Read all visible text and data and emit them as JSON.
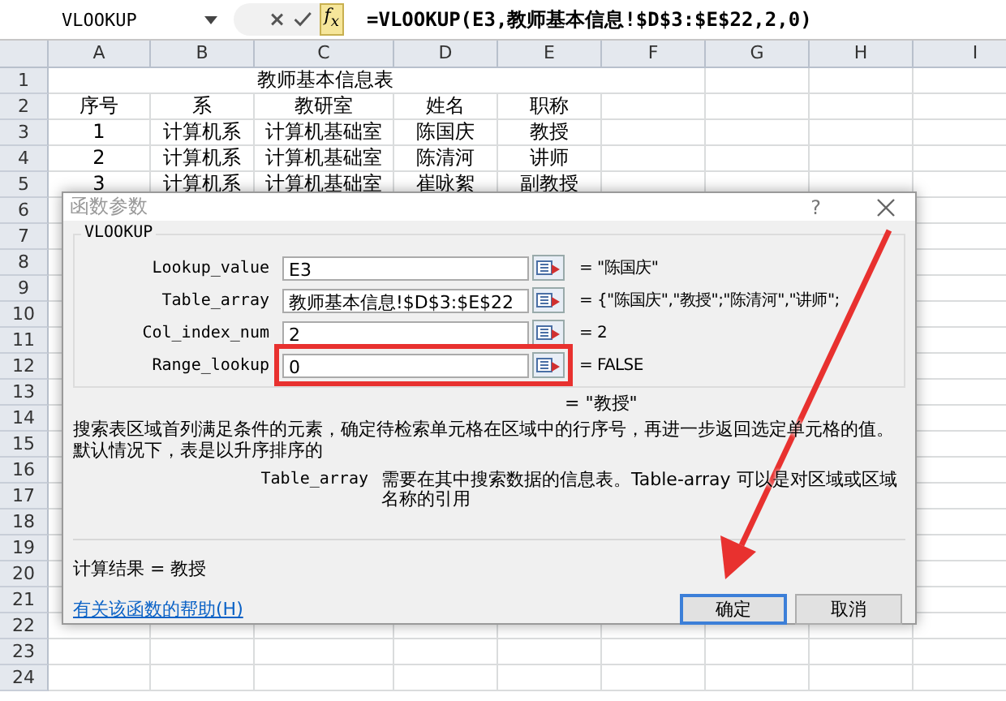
{
  "name_box": "VLOOKUP",
  "formula_bar": {
    "fx": "f$_{x}$",
    "formula": "=VLOOKUP(E3,教师基本信息!$D$3:$E$22,2,0)"
  },
  "sheet": {
    "columns": [
      "A",
      "B",
      "C",
      "D",
      "E",
      "F",
      "G",
      "H",
      "I"
    ],
    "row_numbers": [
      "1",
      "2",
      "3",
      "4",
      "5",
      "6",
      "7",
      "8",
      "9",
      "10",
      "11",
      "12",
      "13",
      "14",
      "15",
      "16",
      "17",
      "18",
      "19",
      "20",
      "21",
      "22",
      "23",
      "24"
    ],
    "title": "教师基本信息表",
    "rows": [
      [
        "序号",
        "系",
        "教研室",
        "姓名",
        "职称"
      ],
      [
        "1",
        "计算机系",
        "计算机基础室",
        "陈国庆",
        "教授"
      ],
      [
        "2",
        "计算机系",
        "计算机基础室",
        "陈清河",
        "讲师"
      ],
      [
        "3",
        "计算机系",
        "计算机基础室",
        "崔咏絮",
        "副教授"
      ]
    ]
  },
  "dialog": {
    "title": "函数参数",
    "help": "?",
    "function": "VLOOKUP",
    "arguments": [
      {
        "label": "Lookup_value",
        "value": "E3",
        "result": "= \"陈国庆\"",
        "highlighted": false
      },
      {
        "label": "Table_array",
        "value": "教师基本信息!$D$3:$E$22",
        "result": "= {\"陈国庆\",\"教授\";\"陈清河\",\"讲师\";",
        "highlighted": false
      },
      {
        "label": "Col_index_num",
        "value": "2",
        "result": "= 2",
        "highlighted": false
      },
      {
        "label": "Range_lookup",
        "value": "0",
        "result": "= FALSE",
        "highlighted": true
      }
    ],
    "result": "= \"教授\"",
    "description": "搜索表区域首列满足条件的元素，确定待检索单元格在区域中的行序号，再进一步返回选定单元格的值。默认情况下，表是以升序排序的",
    "argument_help": {
      "name": "Table_array",
      "text": "需要在其中搜索数据的信息表。Table-array 可以是对区域或区域名称的引用"
    },
    "formula_result": "计算结果 = 教授",
    "help_link": "有关该函数的帮助(H)",
    "buttons": [
      {
        "label": "确定",
        "default": true
      },
      {
        "label": "取消",
        "default": false
      }
    ]
  }
}
